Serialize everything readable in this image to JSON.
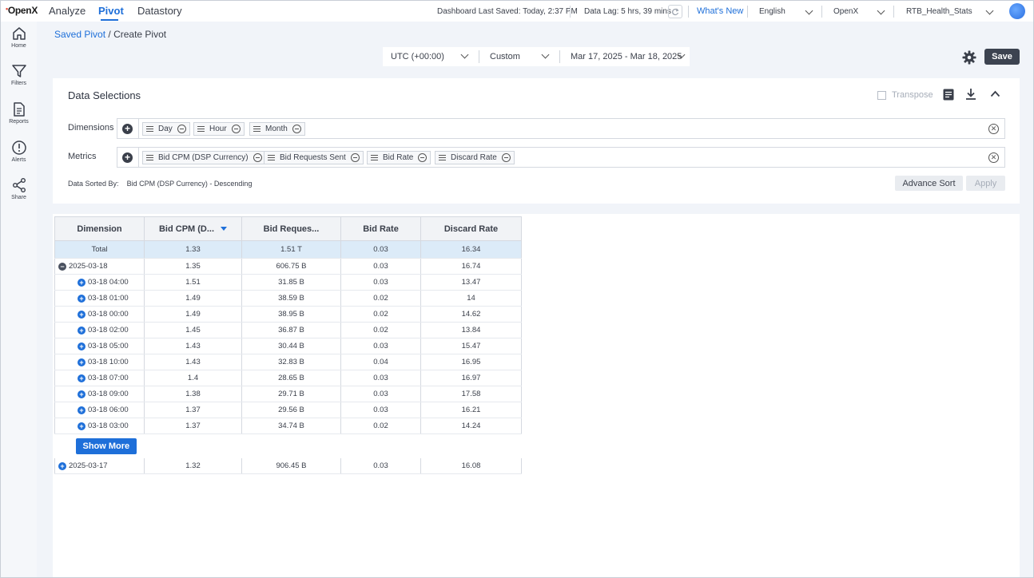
{
  "brand": {
    "logo_text": "OpenX",
    "accent": "#1e6fd9"
  },
  "nav": {
    "tabs": [
      {
        "label": "Analyze"
      },
      {
        "label": "Pivot"
      },
      {
        "label": "Datastory"
      }
    ],
    "active": "Pivot"
  },
  "status": {
    "last_saved": "Dashboard Last Saved: Today, 2:37 PM",
    "data_lag": "Data Lag: 5 hrs, 39 mins",
    "whats_new": "What's New",
    "language": "English",
    "org": "OpenX",
    "dashboard": "RTB_Health_Stats"
  },
  "sidebar": {
    "items": [
      {
        "label": "Home",
        "icon": "home-icon"
      },
      {
        "label": "Filters",
        "icon": "filter-icon"
      },
      {
        "label": "Reports",
        "icon": "report-icon"
      },
      {
        "label": "Alerts",
        "icon": "alert-icon"
      },
      {
        "label": "Share",
        "icon": "share-icon"
      }
    ]
  },
  "breadcrumb": {
    "parent": "Saved Pivot",
    "separator": "/",
    "current": "Create Pivot"
  },
  "date_controls": {
    "timezone": "UTC (+00:00)",
    "range_type": "Custom",
    "range": "Mar 17, 2025 - Mar 18, 2025"
  },
  "toolbar": {
    "save_label": "Save"
  },
  "data_selections": {
    "title": "Data Selections",
    "transpose_label": "Transpose",
    "dimensions_label": "Dimensions",
    "dimensions": [
      "Day",
      "Hour",
      "Month"
    ],
    "metrics_label": "Metrics",
    "metrics": [
      "Bid CPM (DSP Currency)",
      "Bid Requests Sent",
      "Bid Rate",
      "Discard Rate"
    ],
    "sorted_by_label": "Data Sorted By:",
    "sorted_by_value": "Bid CPM (DSP Currency) - Descending",
    "advance_sort_label": "Advance Sort",
    "apply_label": "Apply"
  },
  "table": {
    "headers": [
      "Dimension",
      "Bid CPM (D...",
      "Bid Reques...",
      "Bid Rate",
      "Discard Rate"
    ],
    "total": {
      "label": "Total",
      "cpm": "1.33",
      "requests": "1.51 T",
      "rate": "0.03",
      "discard": "16.34"
    },
    "group1": {
      "label": "2025-03-18",
      "cpm": "1.35",
      "requests": "606.75 B",
      "rate": "0.03",
      "discard": "16.74"
    },
    "rows": [
      {
        "label": "03-18 04:00",
        "cpm": "1.51",
        "requests": "31.85 B",
        "rate": "0.03",
        "discard": "13.47"
      },
      {
        "label": "03-18 01:00",
        "cpm": "1.49",
        "requests": "38.59 B",
        "rate": "0.02",
        "discard": "14"
      },
      {
        "label": "03-18 00:00",
        "cpm": "1.49",
        "requests": "38.95 B",
        "rate": "0.02",
        "discard": "14.62"
      },
      {
        "label": "03-18 02:00",
        "cpm": "1.45",
        "requests": "36.87 B",
        "rate": "0.02",
        "discard": "13.84"
      },
      {
        "label": "03-18 05:00",
        "cpm": "1.43",
        "requests": "30.44 B",
        "rate": "0.03",
        "discard": "15.47"
      },
      {
        "label": "03-18 10:00",
        "cpm": "1.43",
        "requests": "32.83 B",
        "rate": "0.04",
        "discard": "16.95"
      },
      {
        "label": "03-18 07:00",
        "cpm": "1.4",
        "requests": "28.65 B",
        "rate": "0.03",
        "discard": "16.97"
      },
      {
        "label": "03-18 09:00",
        "cpm": "1.38",
        "requests": "29.71 B",
        "rate": "0.03",
        "discard": "17.58"
      },
      {
        "label": "03-18 06:00",
        "cpm": "1.37",
        "requests": "29.56 B",
        "rate": "0.03",
        "discard": "16.21"
      },
      {
        "label": "03-18 03:00",
        "cpm": "1.37",
        "requests": "34.74 B",
        "rate": "0.02",
        "discard": "14.24"
      }
    ],
    "show_more_label": "Show More",
    "group2": {
      "label": "2025-03-17",
      "cpm": "1.32",
      "requests": "906.45 B",
      "rate": "0.03",
      "discard": "16.08"
    }
  }
}
